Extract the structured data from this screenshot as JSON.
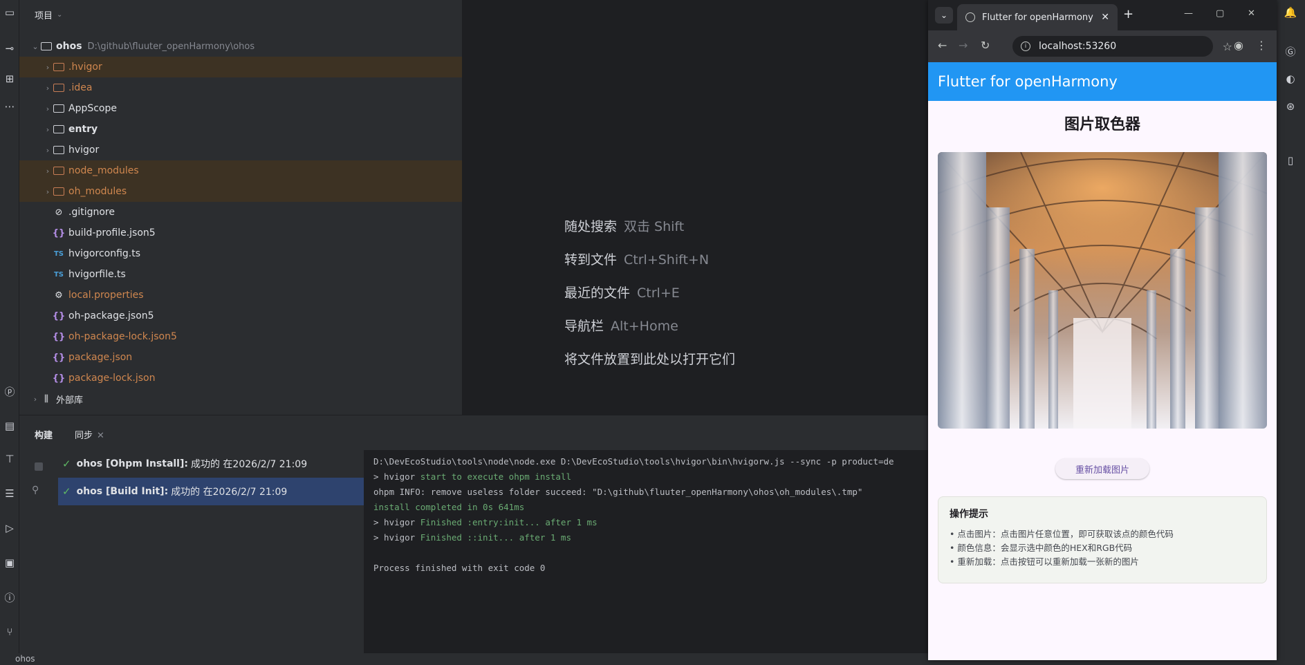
{
  "project_panel": {
    "title": "项目",
    "tree": [
      {
        "name": "ohos",
        "path": "D:\\github\\fluuter_openHarmony\\ohos",
        "kind": "module-folder",
        "expanded": true,
        "level": 0
      },
      {
        "name": ".hvigor",
        "kind": "folder-orange",
        "level": 1
      },
      {
        "name": ".idea",
        "kind": "folder-orange",
        "level": 1
      },
      {
        "name": "AppScope",
        "kind": "folder",
        "level": 1
      },
      {
        "name": "entry",
        "kind": "folder-module",
        "level": 1
      },
      {
        "name": "hvigor",
        "kind": "folder",
        "level": 1
      },
      {
        "name": "node_modules",
        "kind": "folder-orange",
        "level": 1
      },
      {
        "name": "oh_modules",
        "kind": "folder-orange",
        "level": 1
      },
      {
        "name": ".gitignore",
        "kind": "ignore-file",
        "level": 1
      },
      {
        "name": "build-profile.json5",
        "kind": "json-file",
        "level": 1
      },
      {
        "name": "hvigorconfig.ts",
        "kind": "ts-file",
        "level": 1
      },
      {
        "name": "hvigorfile.ts",
        "kind": "ts-file",
        "level": 1
      },
      {
        "name": "local.properties",
        "kind": "properties-file",
        "level": 1
      },
      {
        "name": "oh-package.json5",
        "kind": "json-file",
        "level": 1
      },
      {
        "name": "oh-package-lock.json5",
        "kind": "json-file",
        "level": 1
      },
      {
        "name": "package.json",
        "kind": "json-file",
        "level": 1
      },
      {
        "name": "package-lock.json",
        "kind": "json-file",
        "level": 1
      },
      {
        "name": "外部库",
        "kind": "library",
        "level": 0
      }
    ]
  },
  "editor_hints": [
    {
      "label": "随处搜索",
      "shortcut": "双击 Shift"
    },
    {
      "label": "转到文件",
      "shortcut": "Ctrl+Shift+N"
    },
    {
      "label": "最近的文件",
      "shortcut": "Ctrl+E"
    },
    {
      "label": "导航栏",
      "shortcut": "Alt+Home"
    },
    {
      "label": "将文件放置到此处以打开它们",
      "shortcut": ""
    }
  ],
  "build_panel": {
    "tabs": [
      {
        "label": "构建"
      },
      {
        "label": "同步"
      }
    ],
    "items": [
      {
        "title": "ohos [Ohpm Install]:",
        "status": "成功的 在2026/2/7 21:09"
      },
      {
        "title": "ohos [Build Init]:",
        "status": "成功的 在2026/2/7 21:09"
      }
    ],
    "console": [
      {
        "prefix": "",
        "text": "D:\\DevEcoStudio\\tools\\node\\node.exe D:\\DevEcoStudio\\tools\\hvigor\\bin\\hvigorw.js --sync -p product=de",
        "green": ""
      },
      {
        "prefix": "> hvigor ",
        "text": "",
        "green": "start to execute ohpm install"
      },
      {
        "prefix": "",
        "text": "ohpm INFO: remove useless folder succeed: \"D:\\github\\fluuter_openHarmony\\ohos\\oh_modules\\.tmp\"",
        "green": ""
      },
      {
        "prefix": "",
        "text": "",
        "green": "install completed in 0s 641ms"
      },
      {
        "prefix": "> hvigor ",
        "text": "",
        "green": "Finished :entry:init... after 1 ms"
      },
      {
        "prefix": "> hvigor ",
        "text": "",
        "green": "Finished ::init... after 1 ms"
      },
      {
        "prefix": "",
        "text": "",
        "green": ""
      },
      {
        "prefix": "",
        "text": "Process finished with exit code 0",
        "green": ""
      }
    ]
  },
  "status_bar": {
    "project": "ohos"
  },
  "browser": {
    "tab_title": "Flutter for openHarmony",
    "url": "localhost:53260",
    "app_bar_title": "Flutter for openHarmony",
    "page_title": "图片取色器",
    "reload_button": "重新加载图片",
    "tips": {
      "title": "操作提示",
      "items": [
        "• 点击图片：点击图片任意位置，即可获取该点的颜色代码",
        "• 颜色信息：会显示选中颜色的HEX和RGB代码",
        "• 重新加载：点击按钮可以重新加载一张新的图片"
      ]
    },
    "colors": {
      "app_bar": "#2196f3",
      "page_bg": "#fdf7ff",
      "button_text": "#6750a4"
    }
  },
  "ide_colors": {
    "panel_bg": "#2b2d30",
    "editor_bg": "#1e1f22",
    "selection": "#2e436e",
    "ignored_highlight": "#3d3223",
    "success_green": "#5fb864"
  }
}
